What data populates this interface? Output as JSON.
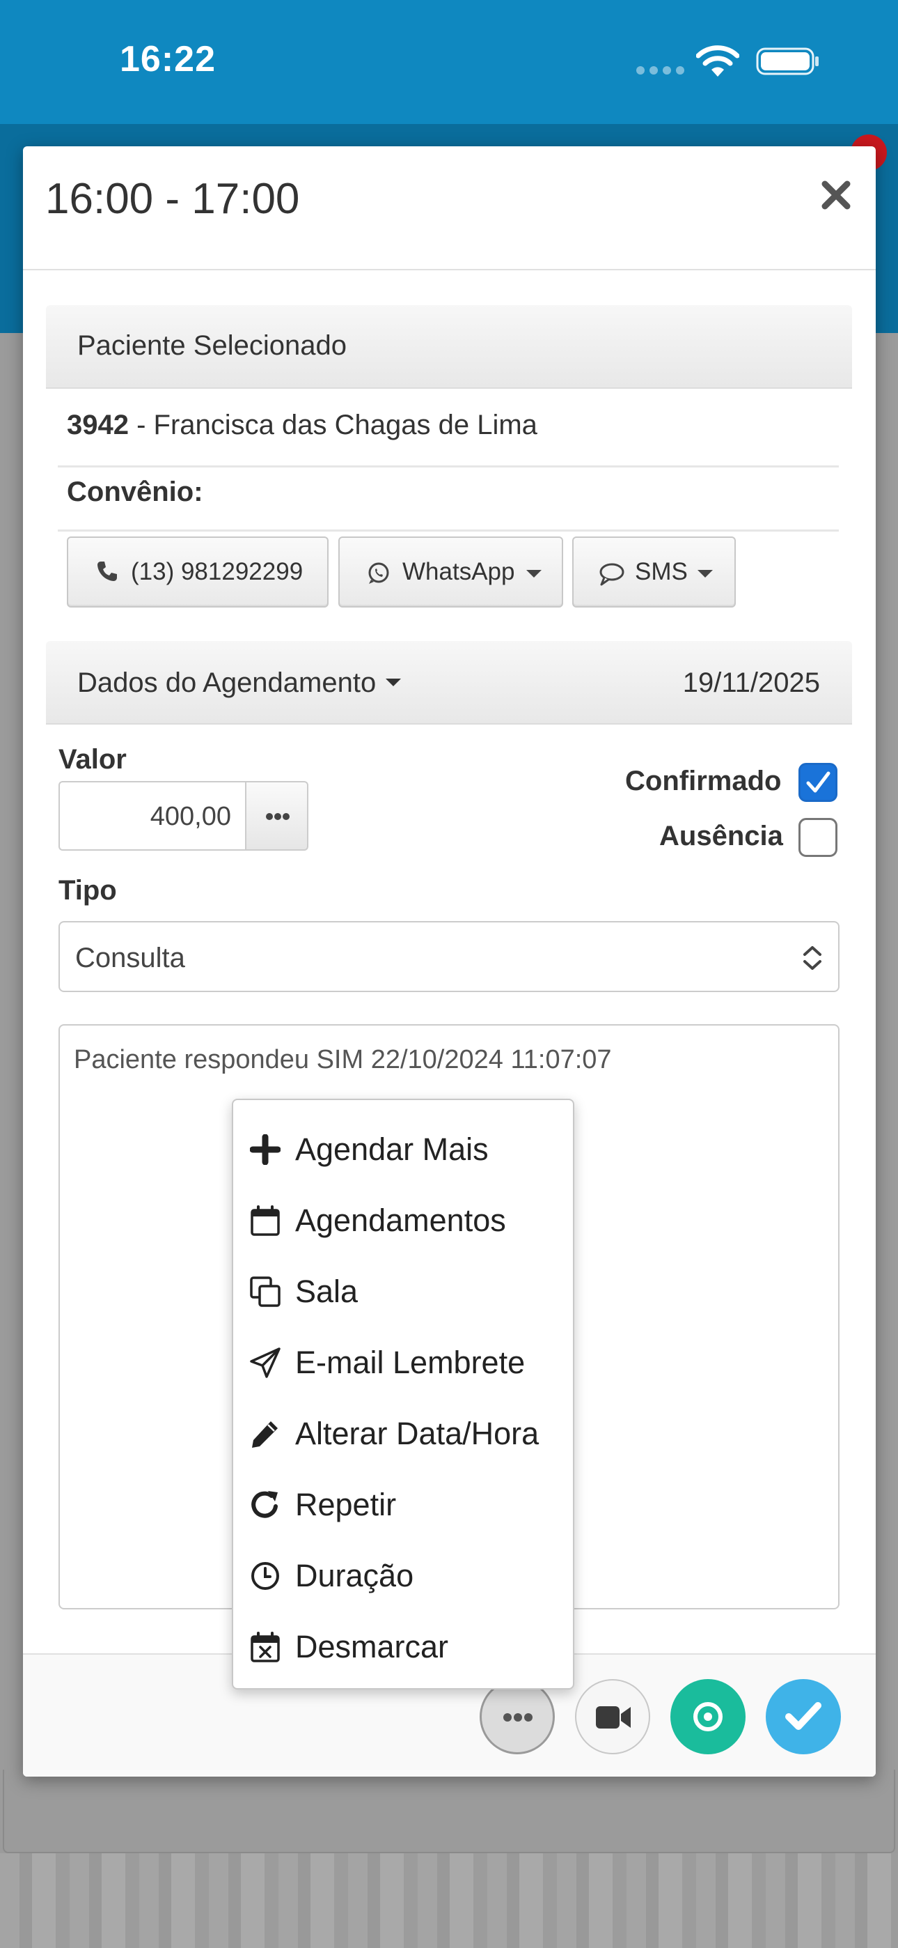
{
  "status_bar": {
    "time": "16:22"
  },
  "modal": {
    "title": "16:00 - 17:00",
    "patient_panel": {
      "heading": "Paciente Selecionado",
      "patient_id": "3942",
      "patient_name": " - Francisca das Chagas de Lima",
      "convenio_label": "Convênio:",
      "phone_label": "(13) 981292299",
      "whatsapp_label": "WhatsApp",
      "sms_label": "SMS"
    },
    "schedule_panel": {
      "heading": "Dados do Agendamento",
      "date": "19/11/2025",
      "valor_label": "Valor",
      "valor_value": "400,00",
      "confirmado_label": "Confirmado",
      "confirmado_checked": true,
      "ausencia_label": "Ausência",
      "ausencia_checked": false,
      "tipo_label": "Tipo",
      "tipo_selected": "Consulta",
      "notes": "Paciente respondeu SIM 22/10/2024 11:07:07"
    }
  },
  "actions_menu": {
    "items": [
      {
        "label": "Agendar Mais",
        "icon": "plus-icon"
      },
      {
        "label": "Agendamentos",
        "icon": "calendar-icon"
      },
      {
        "label": "Sala",
        "icon": "copy-icon"
      },
      {
        "label": "E-mail Lembrete",
        "icon": "paper-plane-icon"
      },
      {
        "label": "Alterar Data/Hora",
        "icon": "pencil-icon"
      },
      {
        "label": "Repetir",
        "icon": "repeat-icon"
      },
      {
        "label": "Duração",
        "icon": "clock-icon"
      },
      {
        "label": "Desmarcar",
        "icon": "calendar-x-icon"
      }
    ]
  },
  "colors": {
    "status_bar": "#0f88c0",
    "checkbox_checked": "#1a73d9",
    "teal_button": "#1abc9c",
    "confirm_button": "#3fb3e8"
  }
}
